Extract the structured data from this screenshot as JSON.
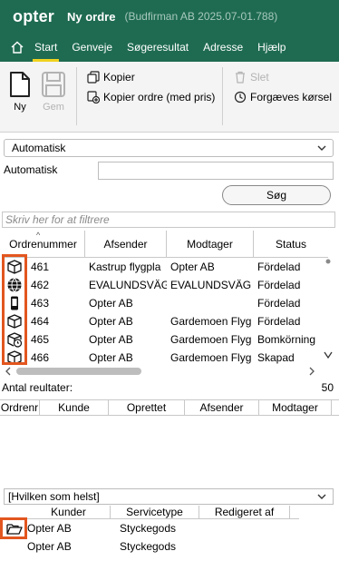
{
  "app": {
    "logo": "opter",
    "title": "Ny ordre",
    "subtitle": "(Budfirman AB 2025.07-01.788)"
  },
  "menu": {
    "items": [
      "Start",
      "Genveje",
      "Søgeresultat",
      "Adresse",
      "Hjælp"
    ],
    "active": "Start"
  },
  "ribbon": {
    "new_label": "Ny",
    "save_label": "Gem",
    "copy_label": "Kopier",
    "copy_price_label": "Kopier ordre (med pris)",
    "delete_label": "Slet",
    "failed_label": "Forgæves kørsel"
  },
  "filter": {
    "mode_value": "Automatisk",
    "field_label": "Automatisk",
    "field_value": "",
    "search_button": "Søg",
    "filter_placeholder": "Skriv her for at filtrere"
  },
  "orders": {
    "columns": [
      "Ordrenummer",
      "Afsender",
      "Modtager",
      "Status"
    ],
    "rows": [
      {
        "icon": "package-icon",
        "nr": "461",
        "sender": "Kastrup flygpla",
        "receiver": "Opter AB",
        "status": "Fördelad"
      },
      {
        "icon": "globe-icon",
        "nr": "462",
        "sender": "EVALUNDSVÄG",
        "receiver": "EVALUNDSVÄG",
        "status": "Fördelad"
      },
      {
        "icon": "phone-icon",
        "nr": "463",
        "sender": "Opter AB",
        "receiver": "",
        "status": "Fördelad"
      },
      {
        "icon": "package-icon",
        "nr": "464",
        "sender": "Opter AB",
        "receiver": "Gardemoen Flyg",
        "status": "Fördelad"
      },
      {
        "icon": "package-clock-icon",
        "nr": "465",
        "sender": "Opter AB",
        "receiver": "Gardemoen Flyg",
        "status": "Bomkörning"
      },
      {
        "icon": "package-icon",
        "nr": "466",
        "sender": "Opter AB",
        "receiver": "Gardemoen Flyg",
        "status": "Skapad"
      }
    ],
    "count_label": "Antal reultater:",
    "count_value": "50"
  },
  "details": {
    "columns": [
      "Ordrenr",
      "Kunde",
      "Oprettet",
      "Afsender",
      "Modtager"
    ]
  },
  "bottom": {
    "combo_value": "[Hvilken som helst]",
    "columns": [
      "Kunder",
      "Servicetype",
      "Redigeret af"
    ],
    "rows": [
      {
        "customer": "Opter AB",
        "service": "Styckegods"
      },
      {
        "customer": "Opter AB",
        "service": "Styckegods"
      }
    ]
  }
}
